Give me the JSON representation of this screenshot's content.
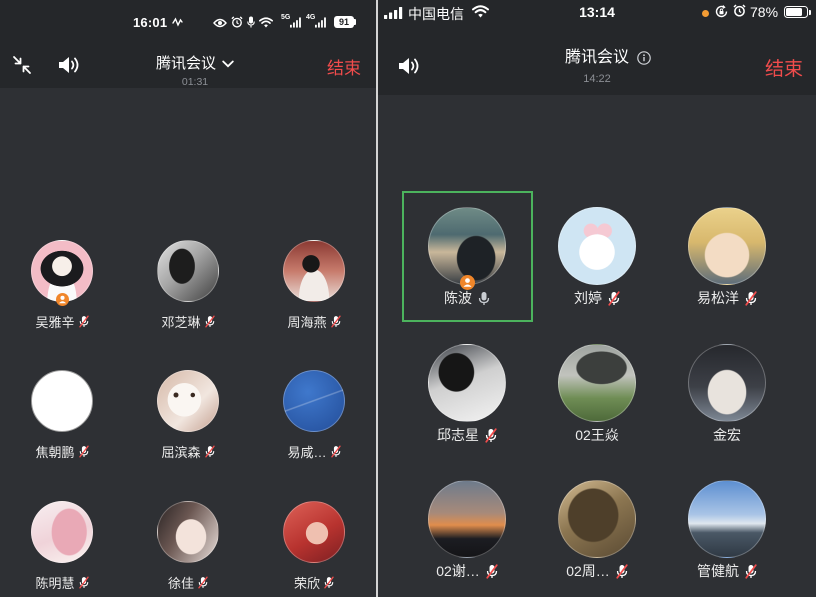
{
  "colors": {
    "end_button": "#f14c4c",
    "active_speaker_border": "#4cb35d",
    "host_badge": "#f0862a",
    "muted_slash": "#f14c4c"
  },
  "left_phone": {
    "status_bar": {
      "time": "16:01",
      "net_5g": "5G",
      "net_4g": "4G",
      "battery": "91"
    },
    "header": {
      "title": "腾讯会议",
      "duration": "01:31",
      "end_label": "结束"
    },
    "participants": [
      {
        "name": "吴雅辛",
        "mic": "mic-muted-icon",
        "host": true
      },
      {
        "name": "邓芝琳",
        "mic": "mic-muted-icon"
      },
      {
        "name": "周海燕",
        "mic": "mic-muted-icon"
      },
      {
        "name": "焦朝鹏",
        "mic": "mic-muted-icon"
      },
      {
        "name": "屈滨森",
        "mic": "mic-muted-icon"
      },
      {
        "name": "易咸…",
        "mic": "mic-muted-icon"
      },
      {
        "name": "陈明慧",
        "mic": "mic-muted-icon"
      },
      {
        "name": "徐佳",
        "mic": "mic-muted-icon"
      },
      {
        "name": "荣欣",
        "mic": "mic-muted-icon"
      }
    ]
  },
  "right_phone": {
    "status_bar": {
      "carrier": "中国电信",
      "time": "13:14",
      "battery": "78%"
    },
    "header": {
      "title": "腾讯会议",
      "duration": "14:22",
      "end_label": "结束"
    },
    "participants": [
      {
        "name": "陈波",
        "mic": "mic-on-icon",
        "host": true,
        "active_speaker": true
      },
      {
        "name": "刘婷",
        "mic": "mic-muted-icon"
      },
      {
        "name": "易松洋",
        "mic": "mic-muted-icon"
      },
      {
        "name": "邱志星",
        "mic": "mic-muted-icon"
      },
      {
        "name": "02王焱",
        "mic": null
      },
      {
        "name": "金宏",
        "mic": null
      },
      {
        "name": "02谢…",
        "mic": "mic-muted-icon"
      },
      {
        "name": "02周…",
        "mic": "mic-muted-icon"
      },
      {
        "name": "管健航",
        "mic": "mic-muted-icon"
      }
    ]
  }
}
